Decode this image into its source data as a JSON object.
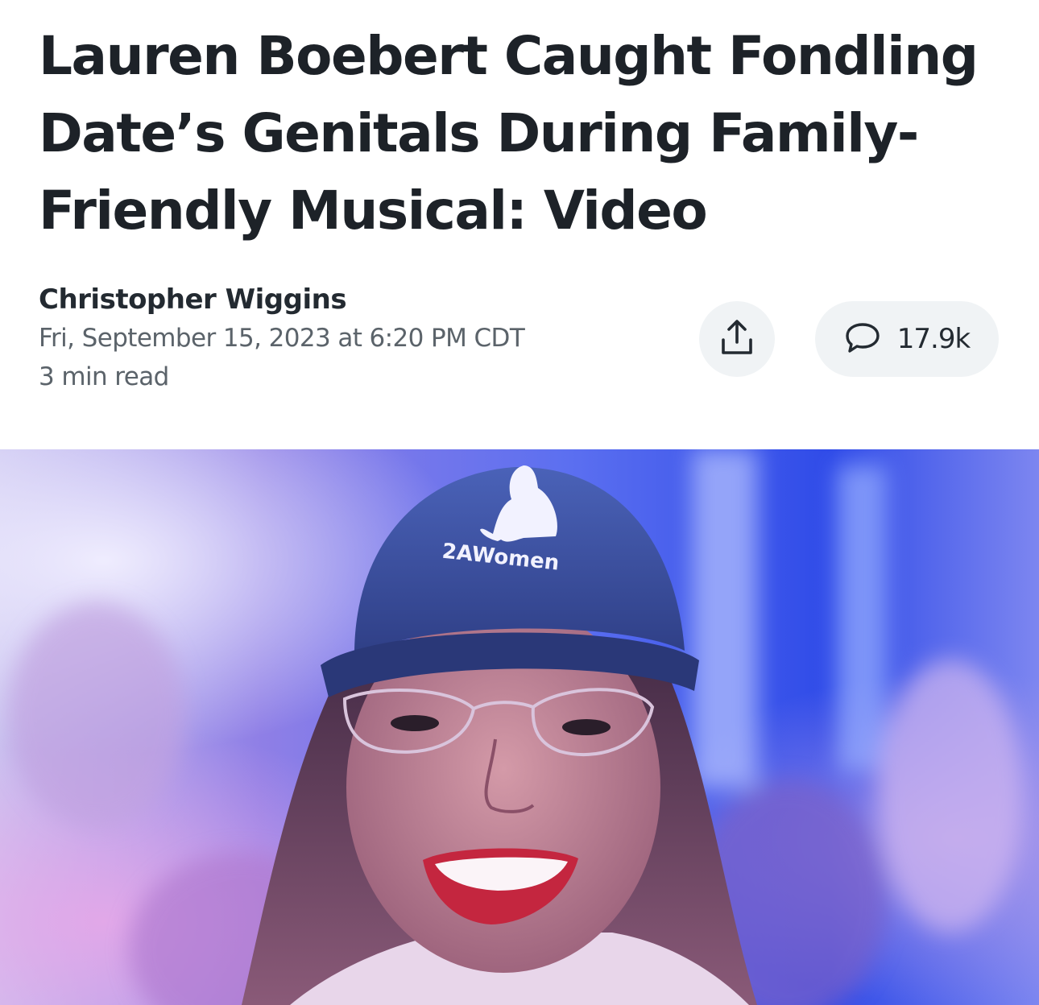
{
  "article": {
    "headline_lines": [
      "Lauren Boebert Caught Fondling",
      "Date’s Genitals During Family-",
      "Friendly Musical: Video"
    ],
    "author": "Christopher Wiggins",
    "published": "Fri, September 15, 2023 at 6:20 PM CDT",
    "read_time": "3 min read"
  },
  "actions": {
    "share_icon": "share-upload-icon",
    "comment_icon": "speech-bubble-icon",
    "comment_count": "17.9k"
  },
  "hero_image": {
    "cap_text": "2AWomen"
  },
  "colors": {
    "headline": "#1d2228",
    "meta": "#5b636a",
    "button_bg": "#f0f3f5"
  }
}
